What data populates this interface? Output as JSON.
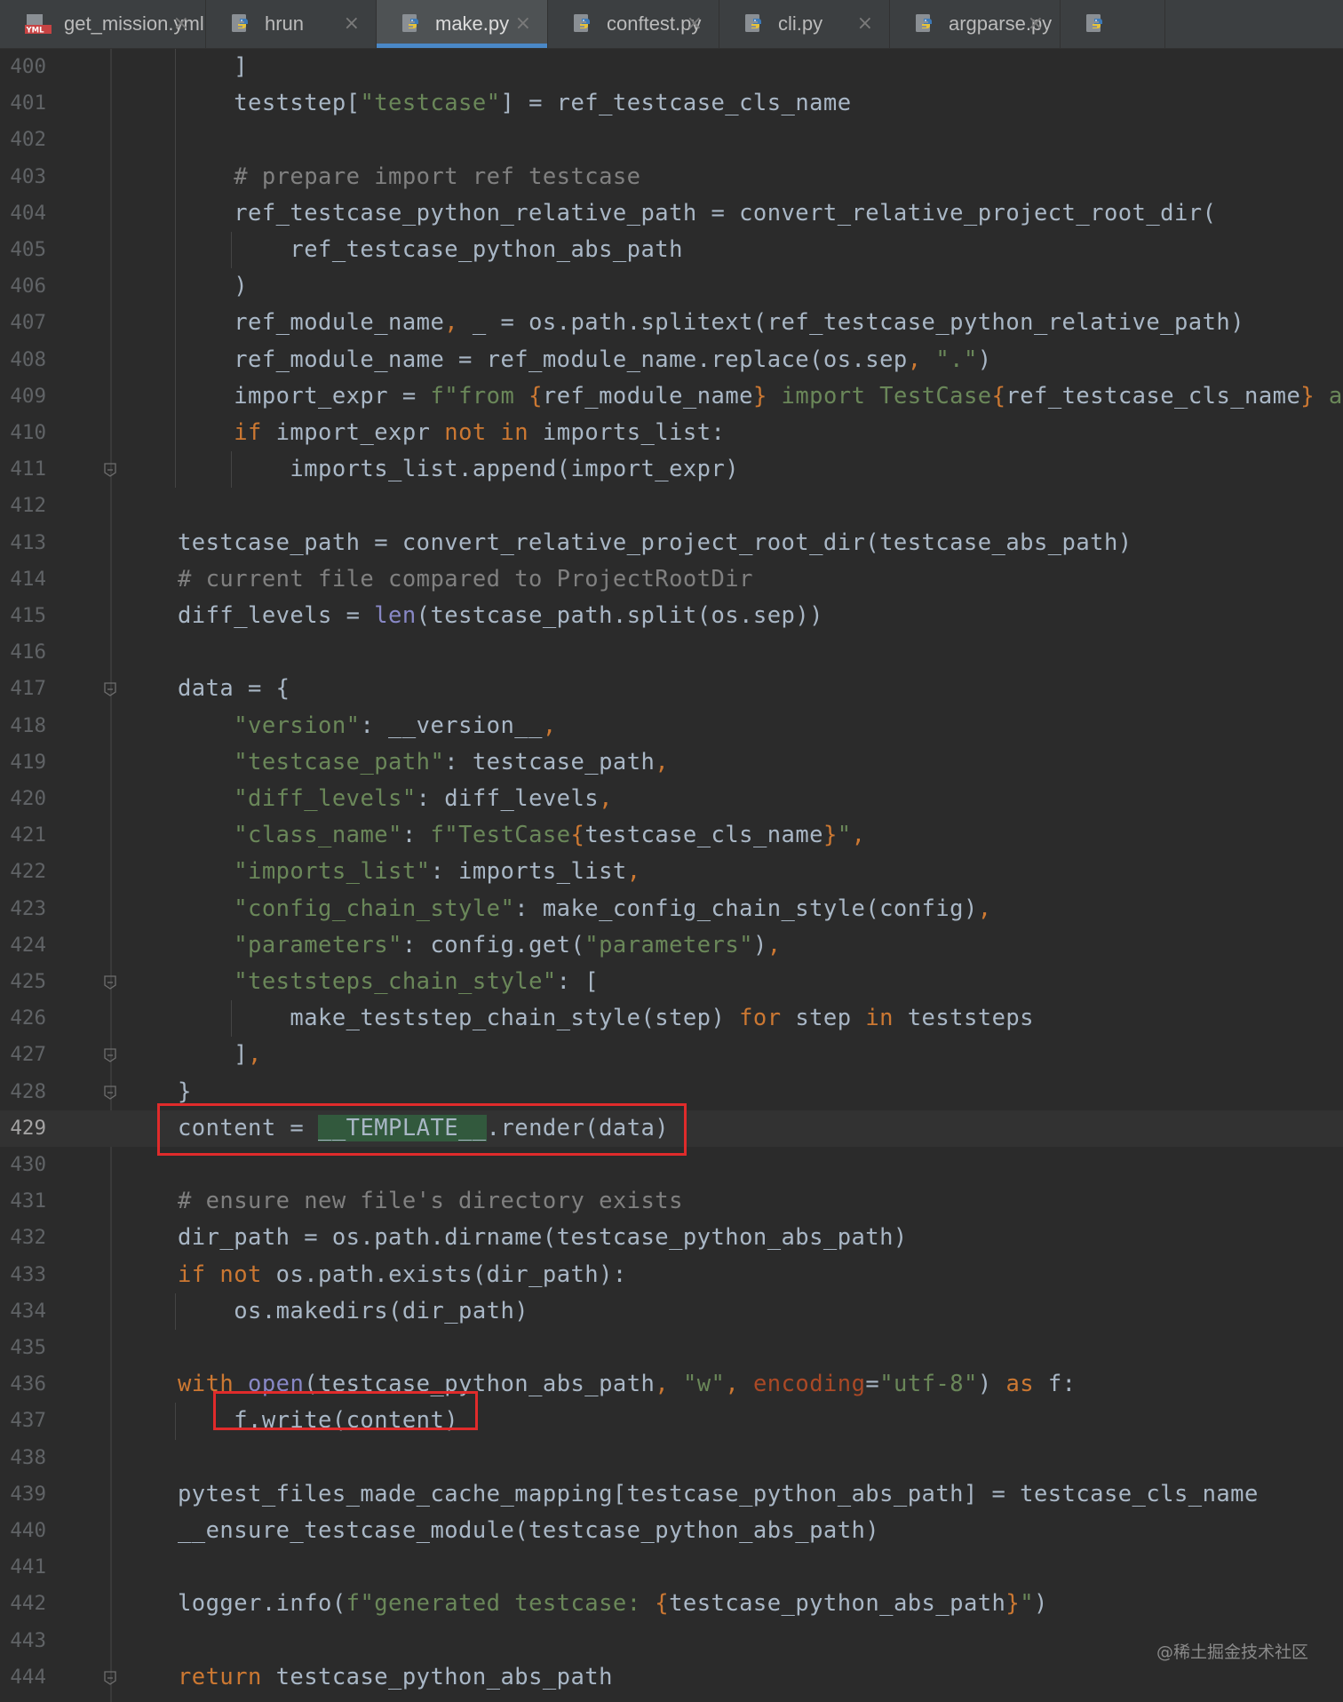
{
  "tabs": [
    {
      "name": "get_mission.yml",
      "type": "yml",
      "active": false
    },
    {
      "name": "hrun",
      "type": "python",
      "active": false
    },
    {
      "name": "make.py",
      "type": "python",
      "active": true
    },
    {
      "name": "conftest.py",
      "type": "python",
      "active": false
    },
    {
      "name": "cli.py",
      "type": "python",
      "active": false
    },
    {
      "name": "argparse.py",
      "type": "python",
      "active": false
    }
  ],
  "tab_close_glyph": "×",
  "editor": {
    "current_line": 429,
    "lines": [
      {
        "n": "400",
        "code": "    ]"
      },
      {
        "n": "401",
        "code": "    teststep[\"testcase\"] = ref_testcase_cls_name"
      },
      {
        "n": "402",
        "code": ""
      },
      {
        "n": "403",
        "code": "    # prepare import ref testcase"
      },
      {
        "n": "404",
        "code": "    ref_testcase_python_relative_path = convert_relative_project_root_dir("
      },
      {
        "n": "405",
        "code": "        ref_testcase_python_abs_path"
      },
      {
        "n": "406",
        "code": "    )"
      },
      {
        "n": "407",
        "code": "    ref_module_name, _ = os.path.splitext(ref_testcase_python_relative_path)"
      },
      {
        "n": "408",
        "code": "    ref_module_name = ref_module_name.replace(os.sep, \".\")"
      },
      {
        "n": "409",
        "code": "    import_expr = f\"from {ref_module_name} import TestCase{ref_testcase_cls_name} as"
      },
      {
        "n": "410",
        "code": "    if import_expr not in imports_list:"
      },
      {
        "n": "411",
        "code": "        imports_list.append(import_expr)"
      },
      {
        "n": "412",
        "code": ""
      },
      {
        "n": "413",
        "code": "testcase_path = convert_relative_project_root_dir(testcase_abs_path)"
      },
      {
        "n": "414",
        "code": "# current file compared to ProjectRootDir"
      },
      {
        "n": "415",
        "code": "diff_levels = len(testcase_path.split(os.sep))"
      },
      {
        "n": "416",
        "code": ""
      },
      {
        "n": "417",
        "code": "data = {"
      },
      {
        "n": "418",
        "code": "    \"version\": __version__,"
      },
      {
        "n": "419",
        "code": "    \"testcase_path\": testcase_path,"
      },
      {
        "n": "420",
        "code": "    \"diff_levels\": diff_levels,"
      },
      {
        "n": "421",
        "code": "    \"class_name\": f\"TestCase{testcase_cls_name}\","
      },
      {
        "n": "422",
        "code": "    \"imports_list\": imports_list,"
      },
      {
        "n": "423",
        "code": "    \"config_chain_style\": make_config_chain_style(config),"
      },
      {
        "n": "424",
        "code": "    \"parameters\": config.get(\"parameters\"),"
      },
      {
        "n": "425",
        "code": "    \"teststeps_chain_style\": ["
      },
      {
        "n": "426",
        "code": "        make_teststep_chain_style(step) for step in teststeps"
      },
      {
        "n": "427",
        "code": "    ],"
      },
      {
        "n": "428",
        "code": "}"
      },
      {
        "n": "429",
        "code": "content = __TEMPLATE__.render(data)"
      },
      {
        "n": "430",
        "code": ""
      },
      {
        "n": "431",
        "code": "# ensure new file's directory exists"
      },
      {
        "n": "432",
        "code": "dir_path = os.path.dirname(testcase_python_abs_path)"
      },
      {
        "n": "433",
        "code": "if not os.path.exists(dir_path):"
      },
      {
        "n": "434",
        "code": "    os.makedirs(dir_path)"
      },
      {
        "n": "435",
        "code": ""
      },
      {
        "n": "436",
        "code": "with open(testcase_python_abs_path, \"w\", encoding=\"utf-8\") as f:"
      },
      {
        "n": "437",
        "code": "    f.write(content)"
      },
      {
        "n": "438",
        "code": ""
      },
      {
        "n": "439",
        "code": "pytest_files_made_cache_mapping[testcase_python_abs_path] = testcase_cls_name"
      },
      {
        "n": "440",
        "code": "__ensure_testcase_module(testcase_python_abs_path)"
      },
      {
        "n": "441",
        "code": ""
      },
      {
        "n": "442",
        "code": "logger.info(f\"generated testcase: {testcase_python_abs_path}\")"
      },
      {
        "n": "443",
        "code": ""
      },
      {
        "n": "444",
        "code": "return testcase_python_abs_path"
      }
    ],
    "fold_markers_at": [
      "411",
      "417",
      "425",
      "427",
      "428",
      "444"
    ],
    "highlighted_lines": [
      "429",
      "437"
    ]
  },
  "watermark": "@稀土掘金技术社区",
  "colors": {
    "background": "#2b2b2b",
    "keyword": "#cc7832",
    "string": "#6a8759",
    "comment": "#808080",
    "builtin": "#8888c6",
    "highlight_box": "#e02b2b",
    "active_tab_underline": "#4a88c7"
  }
}
